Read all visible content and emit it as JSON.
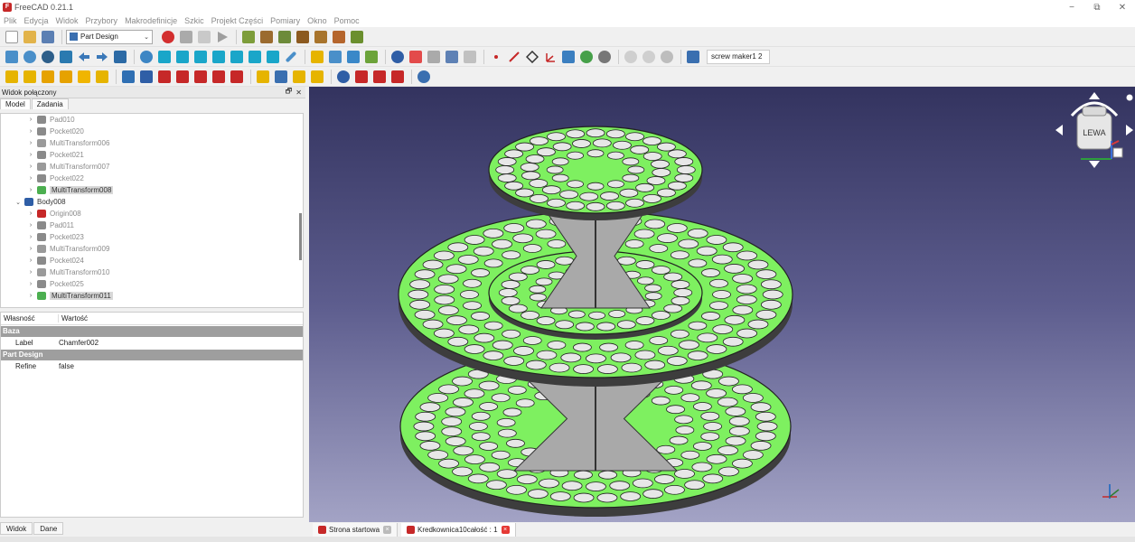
{
  "window": {
    "title": "FreeCAD 0.21.1",
    "app_icon_letter": "F",
    "min": "−",
    "max": "⧉",
    "close": "✕"
  },
  "menu": [
    "Plik",
    "Edycja",
    "Widok",
    "Przybory",
    "Makrodefinicje",
    "Szkic",
    "Projekt Części",
    "Pomiary",
    "Okno",
    "Pomoc"
  ],
  "toolbar": {
    "workbench": "Part Design",
    "macro": "screw maker1 2"
  },
  "combo_view": {
    "title": "Widok połączony",
    "float_btn": "🗗",
    "close_btn": "✕",
    "tab_model": "Model",
    "tab_tasks": "Zadania"
  },
  "tree": [
    {
      "label": "Pad010",
      "level": 2,
      "kind": "pad"
    },
    {
      "label": "Pocket020",
      "level": 2,
      "kind": "pocket"
    },
    {
      "label": "MultiTransform006",
      "level": 2,
      "kind": "multi"
    },
    {
      "label": "Pocket021",
      "level": 2,
      "kind": "pocket"
    },
    {
      "label": "MultiTransform007",
      "level": 2,
      "kind": "multi"
    },
    {
      "label": "Pocket022",
      "level": 2,
      "kind": "pocket"
    },
    {
      "label": "MultiTransform008",
      "level": 2,
      "kind": "multi-active"
    },
    {
      "label": "Body008",
      "level": 1,
      "kind": "body"
    },
    {
      "label": "Origin008",
      "level": 2,
      "kind": "origin"
    },
    {
      "label": "Pad011",
      "level": 2,
      "kind": "pad"
    },
    {
      "label": "Pocket023",
      "level": 2,
      "kind": "pocket"
    },
    {
      "label": "MultiTransform009",
      "level": 2,
      "kind": "multi"
    },
    {
      "label": "Pocket024",
      "level": 2,
      "kind": "pocket"
    },
    {
      "label": "MultiTransform010",
      "level": 2,
      "kind": "multi"
    },
    {
      "label": "Pocket025",
      "level": 2,
      "kind": "pocket"
    },
    {
      "label": "MultiTransform011",
      "level": 2,
      "kind": "multi-active"
    }
  ],
  "properties": {
    "col_property": "Własność",
    "col_value": "Wartość",
    "groups": [
      {
        "name": "Baza",
        "rows": [
          {
            "key": "Label",
            "value": "Chamfer002"
          }
        ]
      },
      {
        "name": "Part Design",
        "rows": [
          {
            "key": "Refine",
            "value": "false"
          }
        ]
      }
    ]
  },
  "bottom_tabs": [
    "Widok",
    "Dane"
  ],
  "navcube": {
    "face": "LEWA"
  },
  "view_tabs": [
    {
      "label": "Strona startowa",
      "active": false
    },
    {
      "label": "Kredkownica10całość : 1",
      "active": true
    }
  ],
  "colors": {
    "model": "#7ef060",
    "hole": "#e7e7e7",
    "bg_top": "#33335f",
    "bg_bottom": "#a3a3c5"
  }
}
